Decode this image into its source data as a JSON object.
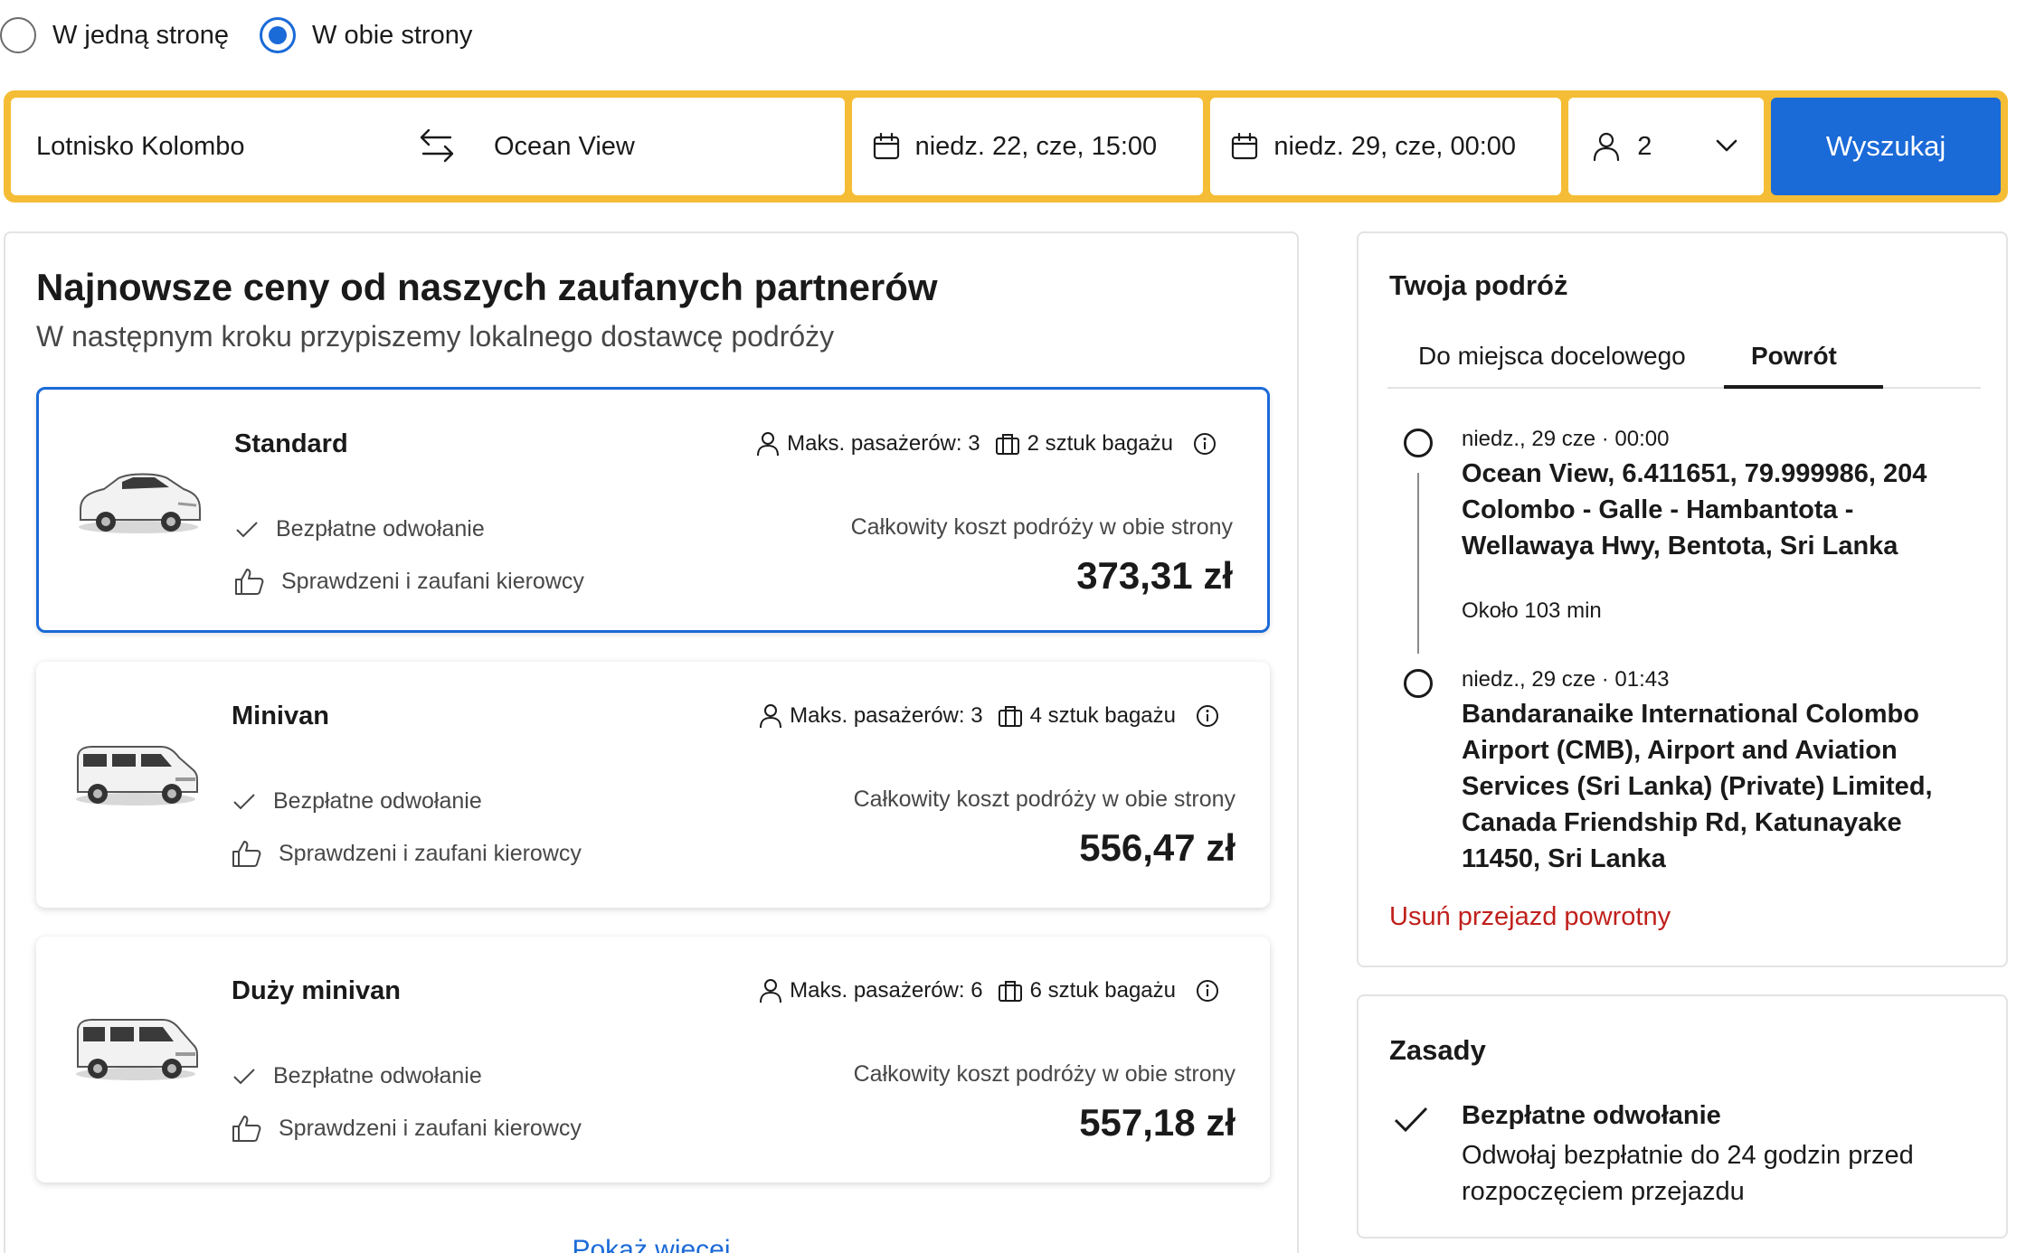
{
  "trip_type": {
    "one_way_label": "W jedną stronę",
    "round_trip_label": "W obie strony",
    "selected": "round_trip"
  },
  "search": {
    "from": "Lotnisko Kolombo",
    "to": "Ocean View",
    "pickup_date": "niedz. 22, cze, 15:00",
    "return_date": "niedz. 29, cze, 00:00",
    "passengers": "2",
    "button_label": "Wyszukaj"
  },
  "results": {
    "title": "Najnowsze ceny od naszych zaufanych partnerów",
    "subtitle": "W następnym kroku przypiszemy lokalnego dostawcę podróży",
    "cards": [
      {
        "name": "Standard",
        "passengers": "Maks. pasażerów: 3",
        "luggage": "2 sztuk bagażu",
        "feature1": "Bezpłatne odwołanie",
        "feature2": "Sprawdzeni i zaufani kierowcy",
        "price_label": "Całkowity koszt podróży w obie strony",
        "price": "373,31 zł",
        "vehicle_icon": "sedan-icon"
      },
      {
        "name": "Minivan",
        "passengers": "Maks. pasażerów: 3",
        "luggage": "4 sztuk bagażu",
        "feature1": "Bezpłatne odwołanie",
        "feature2": "Sprawdzeni i zaufani kierowcy",
        "price_label": "Całkowity koszt podróży w obie strony",
        "price": "556,47 zł",
        "vehicle_icon": "minivan-icon"
      },
      {
        "name": "Duży minivan",
        "passengers": "Maks. pasażerów: 6",
        "luggage": "6 sztuk bagażu",
        "feature1": "Bezpłatne odwołanie",
        "feature2": "Sprawdzeni i zaufani kierowcy",
        "price_label": "Całkowity koszt podróży w obie strony",
        "price": "557,18 zł",
        "vehicle_icon": "large-minivan-icon"
      }
    ],
    "show_more": "Pokaż więcej"
  },
  "trip": {
    "title": "Twoja podróż",
    "tabs": [
      "Do miejsca docelowego",
      "Powrót"
    ],
    "active_tab": "Powrót",
    "stop1_time": "niedz., 29 cze · 00:00",
    "stop1_address": "Ocean View, 6.411651, 79.999986, 204 Colombo - Galle - Hambantota - Wellawaya Hwy, Bentota, Sri Lanka",
    "duration": "Około 103 min",
    "stop2_time": "niedz., 29 cze · 01:43",
    "stop2_address": "Bandaranaike International Colombo Airport (CMB), Airport and Aviation Services (Sri Lanka) (Private) Limited, Canada Friendship Rd, Katunayake 11450, Sri Lanka",
    "remove_return": "Usuń przejazd powrotny"
  },
  "rules": {
    "title": "Zasady",
    "rule_title": "Bezpłatne odwołanie",
    "rule_desc": "Odwołaj bezpłatnie do 24 godzin przed rozpoczęciem przejazdu"
  },
  "colors": {
    "accent_blue": "#1a6ad8",
    "search_border": "#f4bd35",
    "danger_red": "#c0201c"
  }
}
